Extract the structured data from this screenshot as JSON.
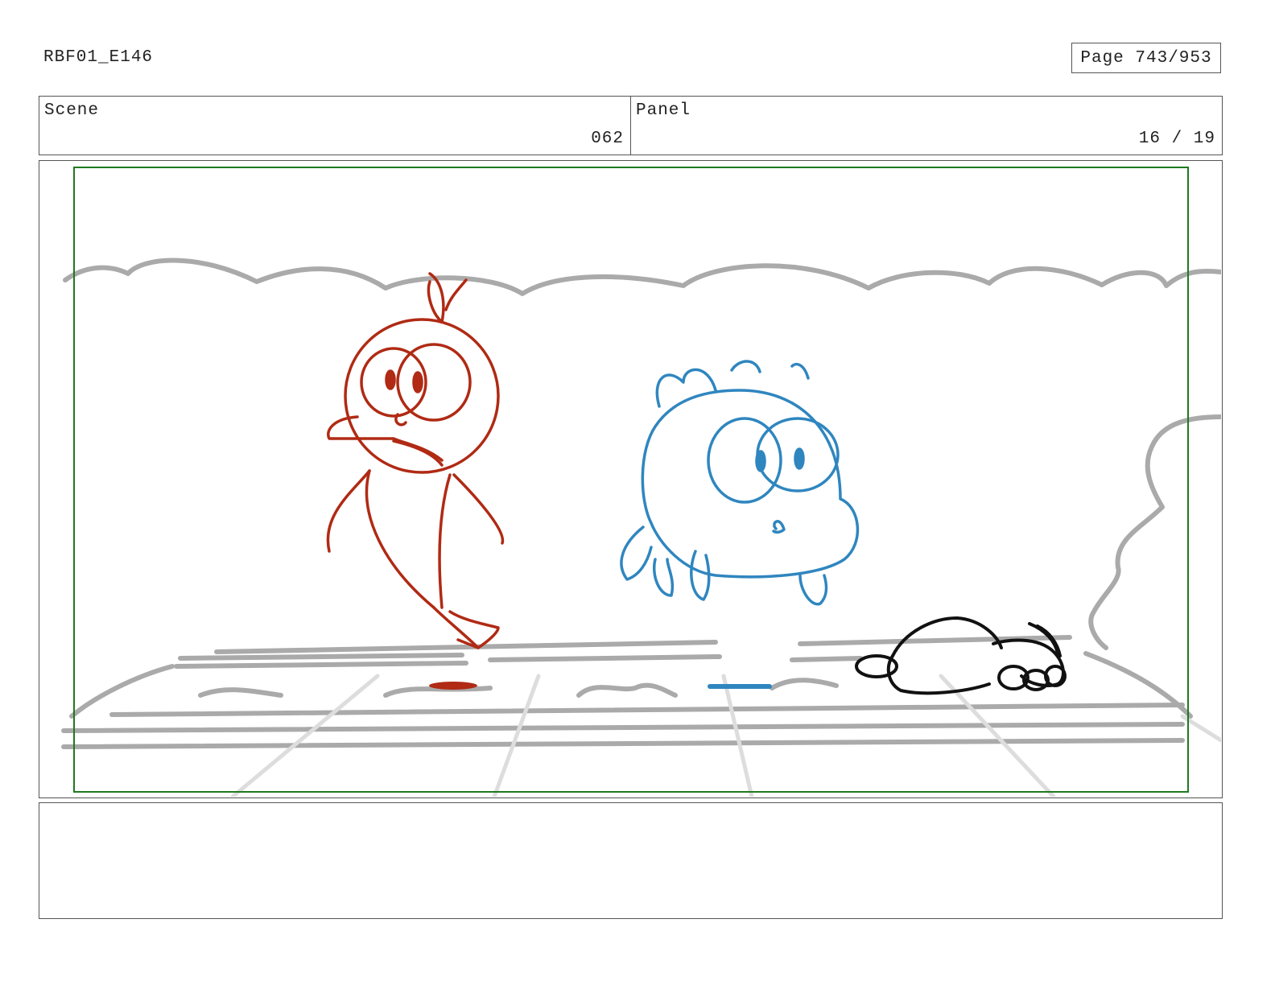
{
  "header": {
    "production_code": "RBF01_E146",
    "page_label": "Page 743/953"
  },
  "scene": {
    "label": "Scene",
    "value": "062"
  },
  "panel": {
    "label": "Panel",
    "value": "16 / 19"
  },
  "notes": {
    "text": ""
  },
  "colors": {
    "red_character": "#b02a14",
    "blue_character": "#2f86bf",
    "black_character": "#111111",
    "background_sketch": "#aaaaaa",
    "safe_area_border": "#1f7a1f"
  }
}
